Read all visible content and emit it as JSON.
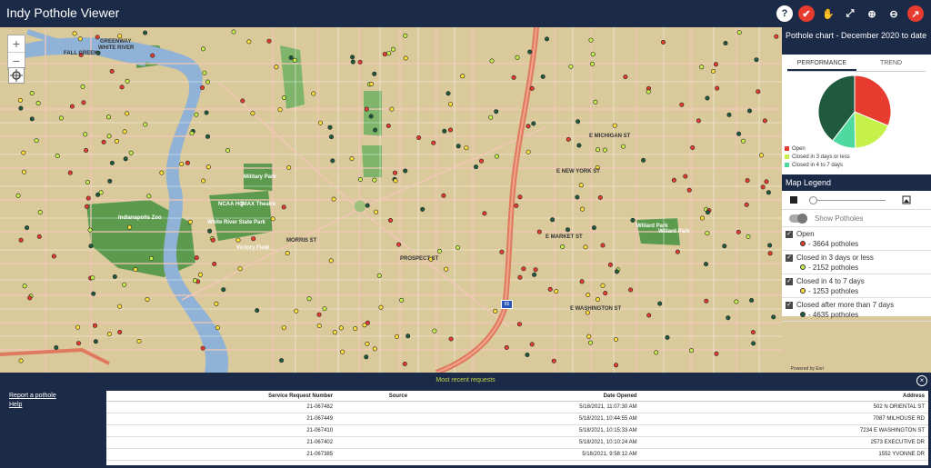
{
  "app": {
    "title": "Indy Pothole Viewer"
  },
  "toolbar": [
    {
      "name": "help-icon",
      "glyph": "?",
      "bg": "#ffffff",
      "fg": "#1b2a47"
    },
    {
      "name": "select-icon",
      "glyph": "✔",
      "bg": "#e63b2e",
      "fg": "#ffffff"
    },
    {
      "name": "pan-hand-icon",
      "glyph": "✋",
      "bg": "transparent",
      "fg": "#ffffff"
    },
    {
      "name": "full-extent-icon",
      "glyph": "⤢",
      "bg": "transparent",
      "fg": "#ffffff"
    },
    {
      "name": "zoom-in-icon",
      "glyph": "⊕",
      "bg": "transparent",
      "fg": "#ffffff"
    },
    {
      "name": "zoom-out-icon",
      "glyph": "⊖",
      "bg": "transparent",
      "fg": "#ffffff"
    },
    {
      "name": "trend-icon",
      "glyph": "↗",
      "bg": "#e63b2e",
      "fg": "#ffffff"
    }
  ],
  "map": {
    "zoom_in": "+",
    "zoom_out": "−",
    "attribution": "Powered by Esri",
    "shield": "65",
    "labels": {
      "greenway": "Greenway",
      "white_river": "White River",
      "fall_creek": "FALL CREEK",
      "military_park": "Military Park",
      "ncaa": "NCAA HQ",
      "imax": "IMAX Theatre",
      "zoo": "Indianapolis Zoo",
      "state_park": "White River State Park",
      "victory": "Victory Field",
      "willard": "Willard Park",
      "washington": "E WASHINGTON ST",
      "new_york": "E NEW YORK ST",
      "michigan": "E MICHIGAN ST",
      "market": "E MARKET ST",
      "prospect": "PROSPECT ST",
      "morris": "MORRIS ST"
    }
  },
  "chart": {
    "title": "Pothole chart - December 2020 to date",
    "tabs": [
      {
        "label": "PERFORMANCE",
        "active": true
      },
      {
        "label": "TREND",
        "active": false
      }
    ],
    "legend": [
      {
        "label": "Open",
        "color": "#e63b2e"
      },
      {
        "label": "Closed in 3 days or less",
        "color": "#c6f04a"
      },
      {
        "label": "Closed in 4 to 7 days",
        "color": "#4fd9a0"
      }
    ]
  },
  "chart_data": {
    "type": "pie",
    "title": "Pothole chart - December 2020 to date",
    "slices": [
      {
        "label": "Open",
        "value": 3664,
        "color": "#e63b2e"
      },
      {
        "label": "Closed in 3 days or less",
        "value": 2152,
        "color": "#c6f04a"
      },
      {
        "label": "Closed in 4 to 7 days",
        "value": 1253,
        "color": "#4fd9a0"
      },
      {
        "label": "Closed after more than 7 days",
        "value": 4635,
        "color": "#1f5a3e"
      }
    ]
  },
  "legend_panel": {
    "title": "Map Legend",
    "toggle_label": "Show Potholes",
    "layers": [
      {
        "label": "Open",
        "count": "- 3664 potholes",
        "color": "#e63b2e"
      },
      {
        "label": "Closed in 3 days or less",
        "count": "- 2152 potholes",
        "color": "#c6f04a"
      },
      {
        "label": "Closed in 4 to 7 days",
        "count": "- 1253 potholes",
        "color": "#ffe03a"
      },
      {
        "label": "Closed after more than 7 days",
        "count": "- 4635 potholes",
        "color": "#1f5a3e"
      }
    ]
  },
  "bottom": {
    "title": "Most recent requests",
    "links": [
      "Report a pothole",
      "Help"
    ],
    "columns": [
      "Service Request Number",
      "Source",
      "Date Opened",
      "Address"
    ],
    "rows": [
      [
        "21-067482",
        "",
        "5/18/2021, 11:07:30 AM",
        "502 N ORIENTAL ST"
      ],
      [
        "21-067449",
        "",
        "5/18/2021, 10:44:55 AM",
        "7087 MILHOUSE RD"
      ],
      [
        "21-067410",
        "",
        "5/18/2021, 10:15:33 AM",
        "7234 E WASHINGTON ST"
      ],
      [
        "21-067402",
        "",
        "5/18/2021, 10:10:24 AM",
        "2573 EXECUTIVE DR"
      ],
      [
        "21-067385",
        "",
        "5/18/2021, 9:58:12 AM",
        "1552 YVONNE DR"
      ]
    ]
  }
}
